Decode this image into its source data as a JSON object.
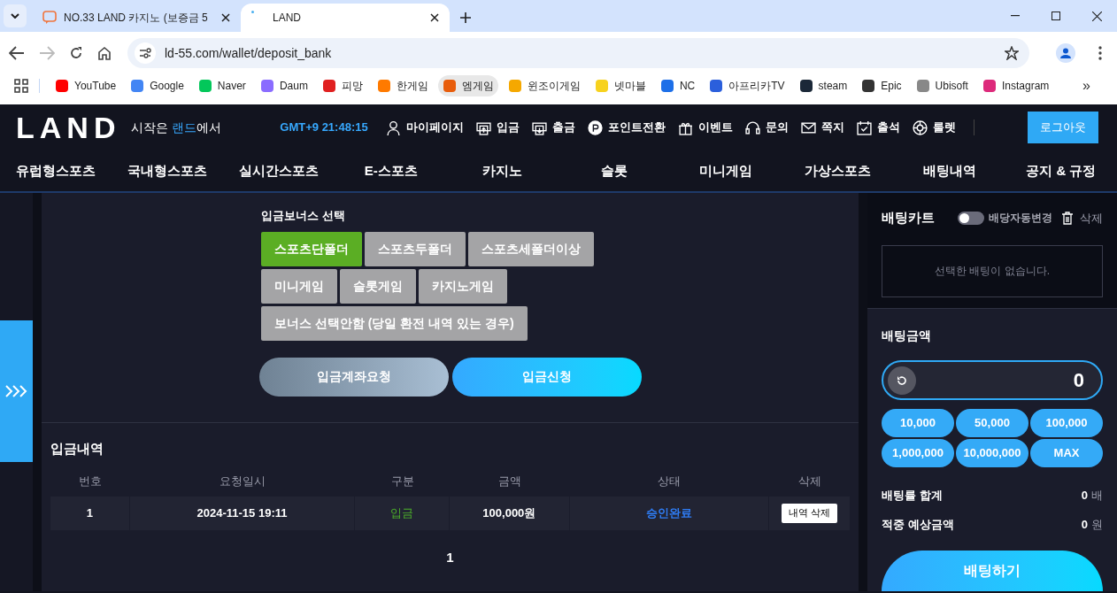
{
  "browser": {
    "tabs": [
      {
        "title": "NO.33 LAND 카지노 (보증금 5",
        "selected": false
      },
      {
        "title": "LAND",
        "selected": true
      }
    ],
    "url": "ld-55.com/wallet/deposit_bank",
    "bookmarks": [
      {
        "label": "YouTube",
        "highlighted": false
      },
      {
        "label": "Google",
        "highlighted": false
      },
      {
        "label": "Naver",
        "highlighted": false
      },
      {
        "label": "Daum",
        "highlighted": false
      },
      {
        "label": "피망",
        "highlighted": false
      },
      {
        "label": "한게임",
        "highlighted": false
      },
      {
        "label": "엠게임",
        "highlighted": true
      },
      {
        "label": "윈조이게임",
        "highlighted": false
      },
      {
        "label": "넷마블",
        "highlighted": false
      },
      {
        "label": "NC",
        "highlighted": false
      },
      {
        "label": "아프리카TV",
        "highlighted": false
      },
      {
        "label": "steam",
        "highlighted": false
      },
      {
        "label": "Epic",
        "highlighted": false
      },
      {
        "label": "Ubisoft",
        "highlighted": false
      },
      {
        "label": "Instagram",
        "highlighted": false
      }
    ],
    "more": "»"
  },
  "header": {
    "logo": "LAND",
    "tagline": [
      {
        "text": "시작은 ",
        "highlight": false
      },
      {
        "text": "랜드",
        "highlight": true
      },
      {
        "text": "에서",
        "highlight": false
      }
    ],
    "clock": "GMT+9 21:48:15",
    "menu": [
      "마이페이지",
      "입금",
      "출금",
      "포인트전환",
      "이벤트",
      "문의",
      "쪽지",
      "출석",
      "룰렛"
    ],
    "logout": "로그아웃"
  },
  "nav": [
    "유럽형스포츠",
    "국내형스포츠",
    "실시간스포츠",
    "E-스포츠",
    "카지노",
    "슬롯",
    "미니게임",
    "가상스포츠",
    "배팅내역",
    "공지 & 규정"
  ],
  "bonus": {
    "title": "입금보너스 선택",
    "rows": [
      [
        {
          "label": "스포츠단폴더",
          "selected": true
        },
        {
          "label": "스포츠두폴더",
          "selected": false
        },
        {
          "label": "스포츠세폴더이상",
          "selected": false
        }
      ],
      [
        {
          "label": "미니게임",
          "selected": false
        },
        {
          "label": "슬롯게임",
          "selected": false
        },
        {
          "label": "카지노게임",
          "selected": false
        }
      ],
      [
        {
          "label": "보너스 선택안함 (당일 환전 내역 있는 경우)",
          "selected": false
        }
      ]
    ],
    "actions": [
      {
        "label": "입금계좌요청",
        "kind": "secondary"
      },
      {
        "label": "입금신청",
        "kind": "primary"
      }
    ]
  },
  "history": {
    "title": "입금내역",
    "columns": [
      "번호",
      "요청일시",
      "구분",
      "금액",
      "상태",
      "삭제"
    ],
    "rows": [
      {
        "number": "1",
        "date": "2024-11-15 19:11",
        "type": "입금",
        "amount": "100,000원",
        "status": "승인완료",
        "action": "내역 삭제"
      }
    ],
    "pages": [
      {
        "label": "1",
        "selected": true
      }
    ]
  },
  "cart": {
    "title": "배팅카트",
    "auto_change": {
      "label": "배당자동변경",
      "on": false
    },
    "clear": "삭제",
    "empty": "선택한 배팅이 없습니다.",
    "amount_title": "배팅금액",
    "amount": "0",
    "chips": [
      "10,000",
      "50,000",
      "100,000",
      "1,000,000",
      "10,000,000",
      "MAX"
    ],
    "summary": [
      {
        "label": "배팅률 합계",
        "value": "0",
        "unit": "배"
      },
      {
        "label": "적중 예상금액",
        "value": "0",
        "unit": "원"
      }
    ],
    "submit": "배팅하기"
  }
}
